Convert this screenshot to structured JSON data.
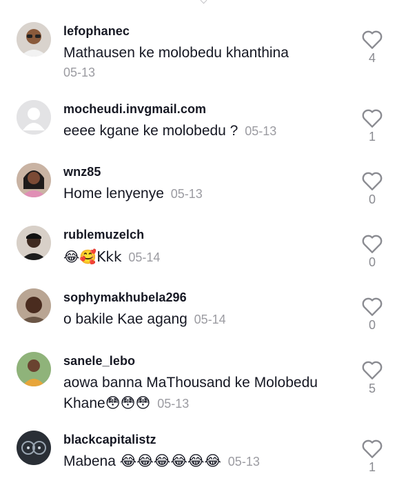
{
  "comments": [
    {
      "username": "lefophanec",
      "text": "Mathausen ke molobedu khanthina",
      "date": "05-13",
      "likes": "4",
      "avatar": "man-with-glasses"
    },
    {
      "username": "mocheudi.invgmail.com",
      "text": "eeee kgane ke molobedu ?",
      "date": "05-13",
      "likes": "1",
      "avatar": "default-gray"
    },
    {
      "username": "wnz85",
      "text": "Home lenyenye",
      "date": "05-13",
      "likes": "0",
      "avatar": "woman-portrait"
    },
    {
      "username": "rublemuzelch",
      "text": "😂🥰Kkk",
      "date": "05-14",
      "likes": "0",
      "avatar": "man-portrait"
    },
    {
      "username": "sophymakhubela296",
      "text": "o bakile Kae agang",
      "date": "05-14",
      "likes": "0",
      "avatar": "woman-portrait-dark"
    },
    {
      "username": "sanele_lebo",
      "text": "aowa banna MaThousand ke Molobedu Khane😳😳😳",
      "date": "05-13",
      "likes": "5",
      "avatar": "man-outdoor"
    },
    {
      "username": "blackcapitalistz",
      "text": "Mabena 😂😂😂😂😂😂",
      "date": "05-13",
      "likes": "1",
      "avatar": "car-dashboard"
    }
  ],
  "colors": {
    "username": "#161823",
    "text": "#161823",
    "date": "#9b9ba1",
    "like_icon": "#8a8b91"
  },
  "icons": {
    "like": "heart-outline-icon"
  }
}
